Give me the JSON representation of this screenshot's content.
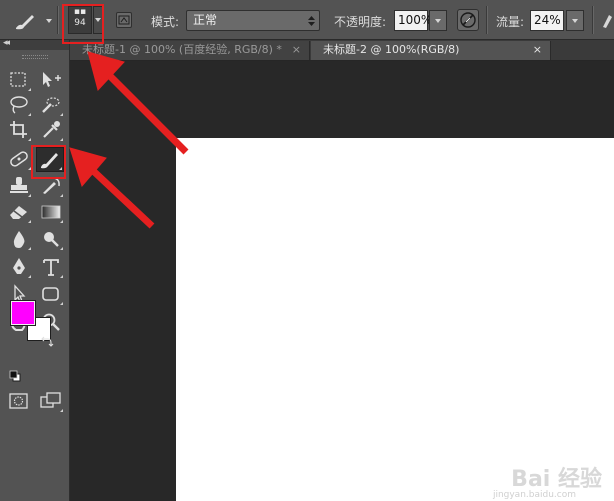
{
  "options_bar": {
    "brush_size": "94",
    "brush_size_prefix": "▪▪",
    "mode_label": "模式:",
    "mode_value": "正常",
    "opacity_label": "不透明度:",
    "opacity_value": "100%",
    "flow_label": "流量:",
    "flow_value": "24%"
  },
  "tabs": [
    {
      "label": "未标题-1 @ 100% (百度经验, RGB/8) *",
      "close": "×",
      "active": false
    },
    {
      "label": "未标题-2 @ 100%(RGB/8)",
      "close": "×",
      "active": true
    }
  ],
  "toolbar": {
    "collapse": "◂◂",
    "foreground_color": "#ff00ff",
    "background_color": "#ffffff"
  },
  "watermark": {
    "text": "Bai 经验",
    "sub": "jingyan.baidu.com"
  },
  "colors": {
    "annotation": "#e52020",
    "canvas": "#ffffff",
    "workspace": "#282828",
    "ui_panel": "#535353"
  }
}
